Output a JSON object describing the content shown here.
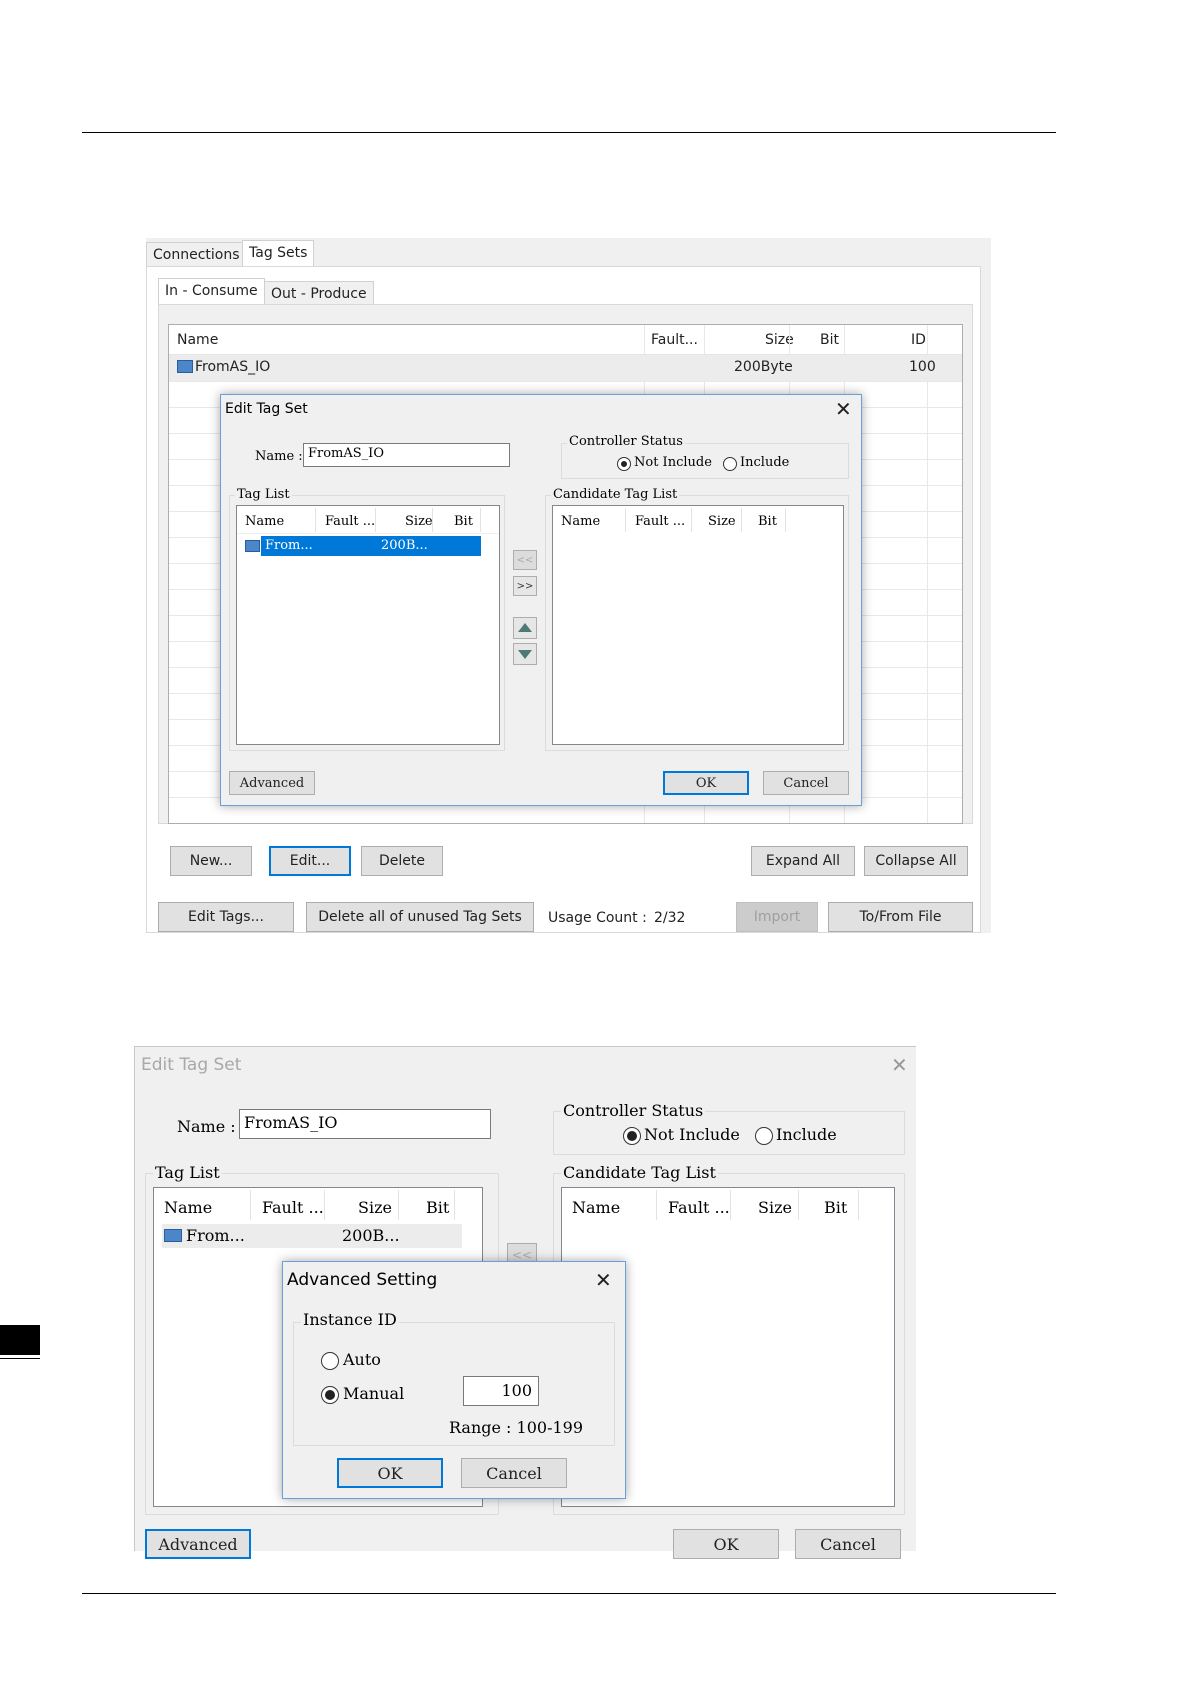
{
  "screen1": {
    "tabs": [
      "Connections",
      "Tag Sets"
    ],
    "subtabs": [
      "In - Consume",
      "Out - Produce"
    ],
    "table": {
      "headers": [
        "Name",
        "Fault...",
        "Size",
        "Bit",
        "ID"
      ],
      "row": {
        "name": "FromAS_IO",
        "size": "200Byte",
        "id": "100"
      }
    },
    "buttons": {
      "new": "New...",
      "edit": "Edit...",
      "delete": "Delete",
      "expand_all": "Expand All",
      "collapse_all": "Collapse All",
      "edit_tags": "Edit Tags...",
      "delete_unused": "Delete all of unused Tag Sets",
      "import": "Import",
      "to_from_file": "To/From File"
    },
    "usage_label": "Usage Count :",
    "usage_value": "2/32",
    "dialog": {
      "title": "Edit Tag Set",
      "name_label": "Name :",
      "name_value": "FromAS_IO",
      "controller_status_label": "Controller Status",
      "not_include": "Not Include",
      "include": "Include",
      "tag_list_label": "Tag List",
      "candidate_label": "Candidate Tag List",
      "headers": [
        "Name",
        "Fault ...",
        "Size",
        "Bit"
      ],
      "tag_row": {
        "name": "From...",
        "size": "200B..."
      },
      "left_arrow": "<<",
      "right_arrow": ">>",
      "advanced": "Advanced",
      "ok": "OK",
      "cancel": "Cancel"
    }
  },
  "screen2": {
    "dialog": {
      "title": "Edit Tag Set",
      "name_label": "Name :",
      "name_value": "FromAS_IO",
      "controller_status_label": "Controller Status",
      "not_include": "Not Include",
      "include": "Include",
      "tag_list_label": "Tag List",
      "candidate_label": "Candidate Tag List",
      "headers": [
        "Name",
        "Fault ...",
        "Size",
        "Bit"
      ],
      "tag_row": {
        "name": "From...",
        "size": "200B..."
      },
      "left_arrow": "<<",
      "advanced": "Advanced",
      "ok": "OK",
      "cancel": "Cancel"
    },
    "advanced_dialog": {
      "title": "Advanced Setting",
      "instance_id_label": "Instance ID",
      "auto": "Auto",
      "manual": "Manual",
      "manual_value": "100",
      "range": "Range : 100-199",
      "ok": "OK",
      "cancel": "Cancel"
    }
  }
}
